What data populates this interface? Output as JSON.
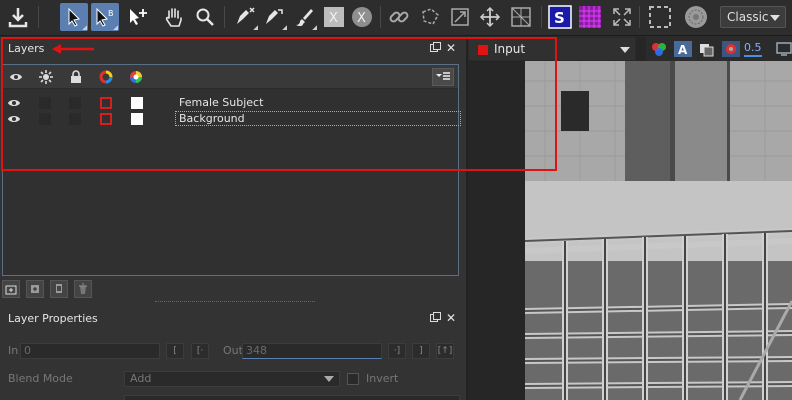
{
  "toolbar": {
    "workspace_dropdown": {
      "value": "Classic"
    },
    "icons": [
      "download-icon",
      "select-arrow-icon",
      "select-bezier-icon",
      "add-point-icon",
      "hand-pan-icon",
      "zoom-magnifier-icon",
      "pen-x-icon",
      "pen-link-icon",
      "brush-icon",
      "x-square-icon",
      "x-circle-icon",
      "link-icon",
      "lasso-icon",
      "scale-icon",
      "move-icon",
      "transform-grid-icon",
      "s-stencil-icon",
      "grid-icon",
      "fit-icon",
      "dashed-rect-icon",
      "circle-target-icon"
    ]
  },
  "layers_panel": {
    "title": "Layers",
    "column_icons": [
      "eye-icon",
      "gear-icon",
      "lock-icon",
      "color-ring-icon",
      "color-wheel-icon"
    ],
    "layers": [
      {
        "name": "Female Subject",
        "selected": false
      },
      {
        "name": "Background",
        "selected": true
      }
    ],
    "tool_buttons": [
      "add-layer-icon",
      "add-folder-icon",
      "duplicate-icon",
      "trash-icon"
    ]
  },
  "layer_properties": {
    "title": "Layer Properties",
    "in_label": "In",
    "in_value": "0",
    "out_label": "Out",
    "out_value": "348",
    "blend_label": "Blend Mode",
    "blend_value": "Add",
    "invert_label": "Invert"
  },
  "viewer": {
    "source_dropdown": {
      "value": "Input",
      "color": "#e01212"
    },
    "zoom_value": "0.5"
  },
  "annotation": {
    "box_color": "#e01212"
  }
}
